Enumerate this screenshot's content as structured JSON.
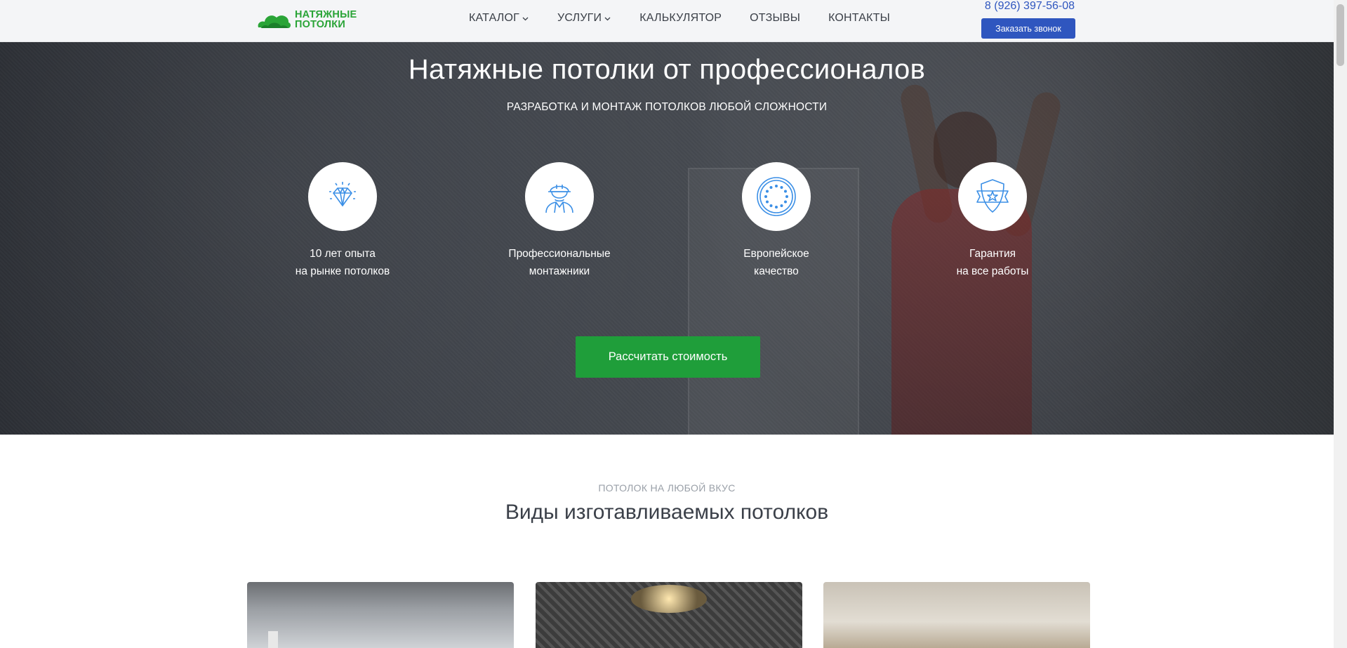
{
  "header": {
    "logo_line1": "НАТЯЖНЫЕ",
    "logo_line2": "ПОТОЛКИ",
    "nav": [
      {
        "label": "КАТАЛОГ",
        "dropdown": true
      },
      {
        "label": "УСЛУГИ",
        "dropdown": true
      },
      {
        "label": "КАЛЬКУЛЯТОР",
        "dropdown": false
      },
      {
        "label": "ОТЗЫВЫ",
        "dropdown": false
      },
      {
        "label": "КОНТАКТЫ",
        "dropdown": false
      }
    ],
    "phone": "8 (926) 397-56-08",
    "callback_label": "Заказать звонок"
  },
  "hero": {
    "title": "Натяжные потолки от профессионалов",
    "subtitle": "РАЗРАБОТКА И МОНТАЖ ПОТОЛКОВ ЛЮБОЙ СЛОЖНОСТИ",
    "features": [
      {
        "icon": "diamond-icon",
        "line1": "10 лет опыта",
        "line2": "на рынке потолков"
      },
      {
        "icon": "worker-helmet-icon",
        "line1": "Профессиональные",
        "line2": "монтажники"
      },
      {
        "icon": "eu-stars-icon",
        "line1": "Европейское",
        "line2": "качество"
      },
      {
        "icon": "shield-star-icon",
        "line1": "Гарантия",
        "line2": "на все работы"
      }
    ],
    "cta_label": "Рассчитать стоимость"
  },
  "catalog": {
    "kicker": "ПОТОЛОК НА ЛЮБОЙ ВКУС",
    "title": "Виды изготавливаемых потолков"
  },
  "colors": {
    "brand_green": "#1f9e3a",
    "accent_blue": "#2f56bf",
    "icon_blue": "#3b8fe6"
  }
}
